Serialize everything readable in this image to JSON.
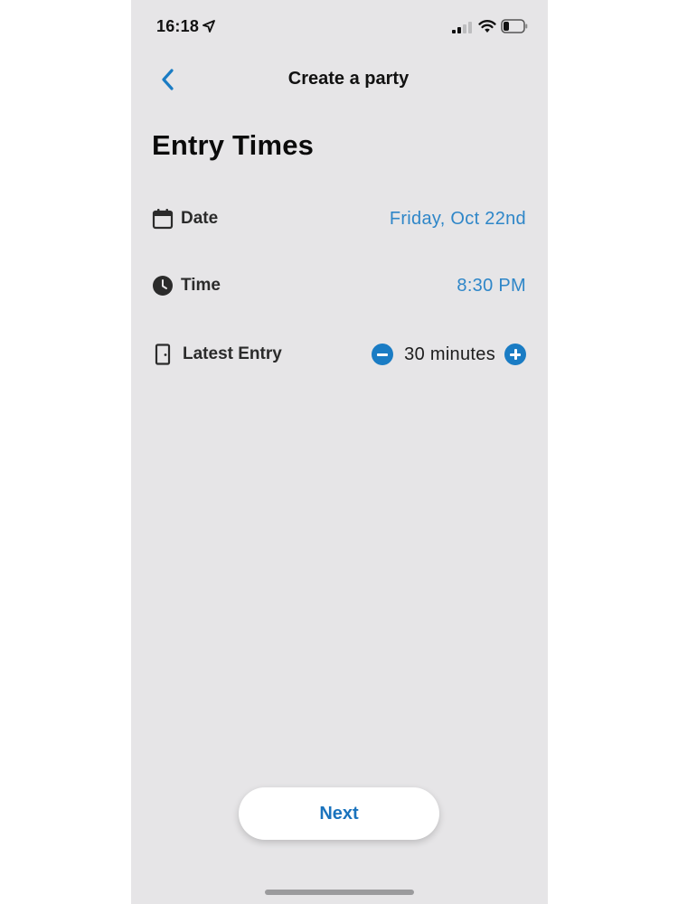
{
  "status_bar": {
    "time": "16:18"
  },
  "nav": {
    "title": "Create a party"
  },
  "page": {
    "title": "Entry Times"
  },
  "rows": {
    "date": {
      "label": "Date",
      "value": "Friday, Oct 22nd",
      "icon": "calendar-icon"
    },
    "time": {
      "label": "Time",
      "value": "8:30 PM",
      "icon": "clock-icon"
    },
    "latest_entry": {
      "label": "Latest Entry",
      "value": "30 minutes",
      "icon": "door-icon"
    }
  },
  "footer": {
    "next_label": "Next"
  },
  "colors": {
    "accent": "#1a7cc4",
    "value_text": "#2e86c8",
    "background": "#e6e5e7"
  }
}
